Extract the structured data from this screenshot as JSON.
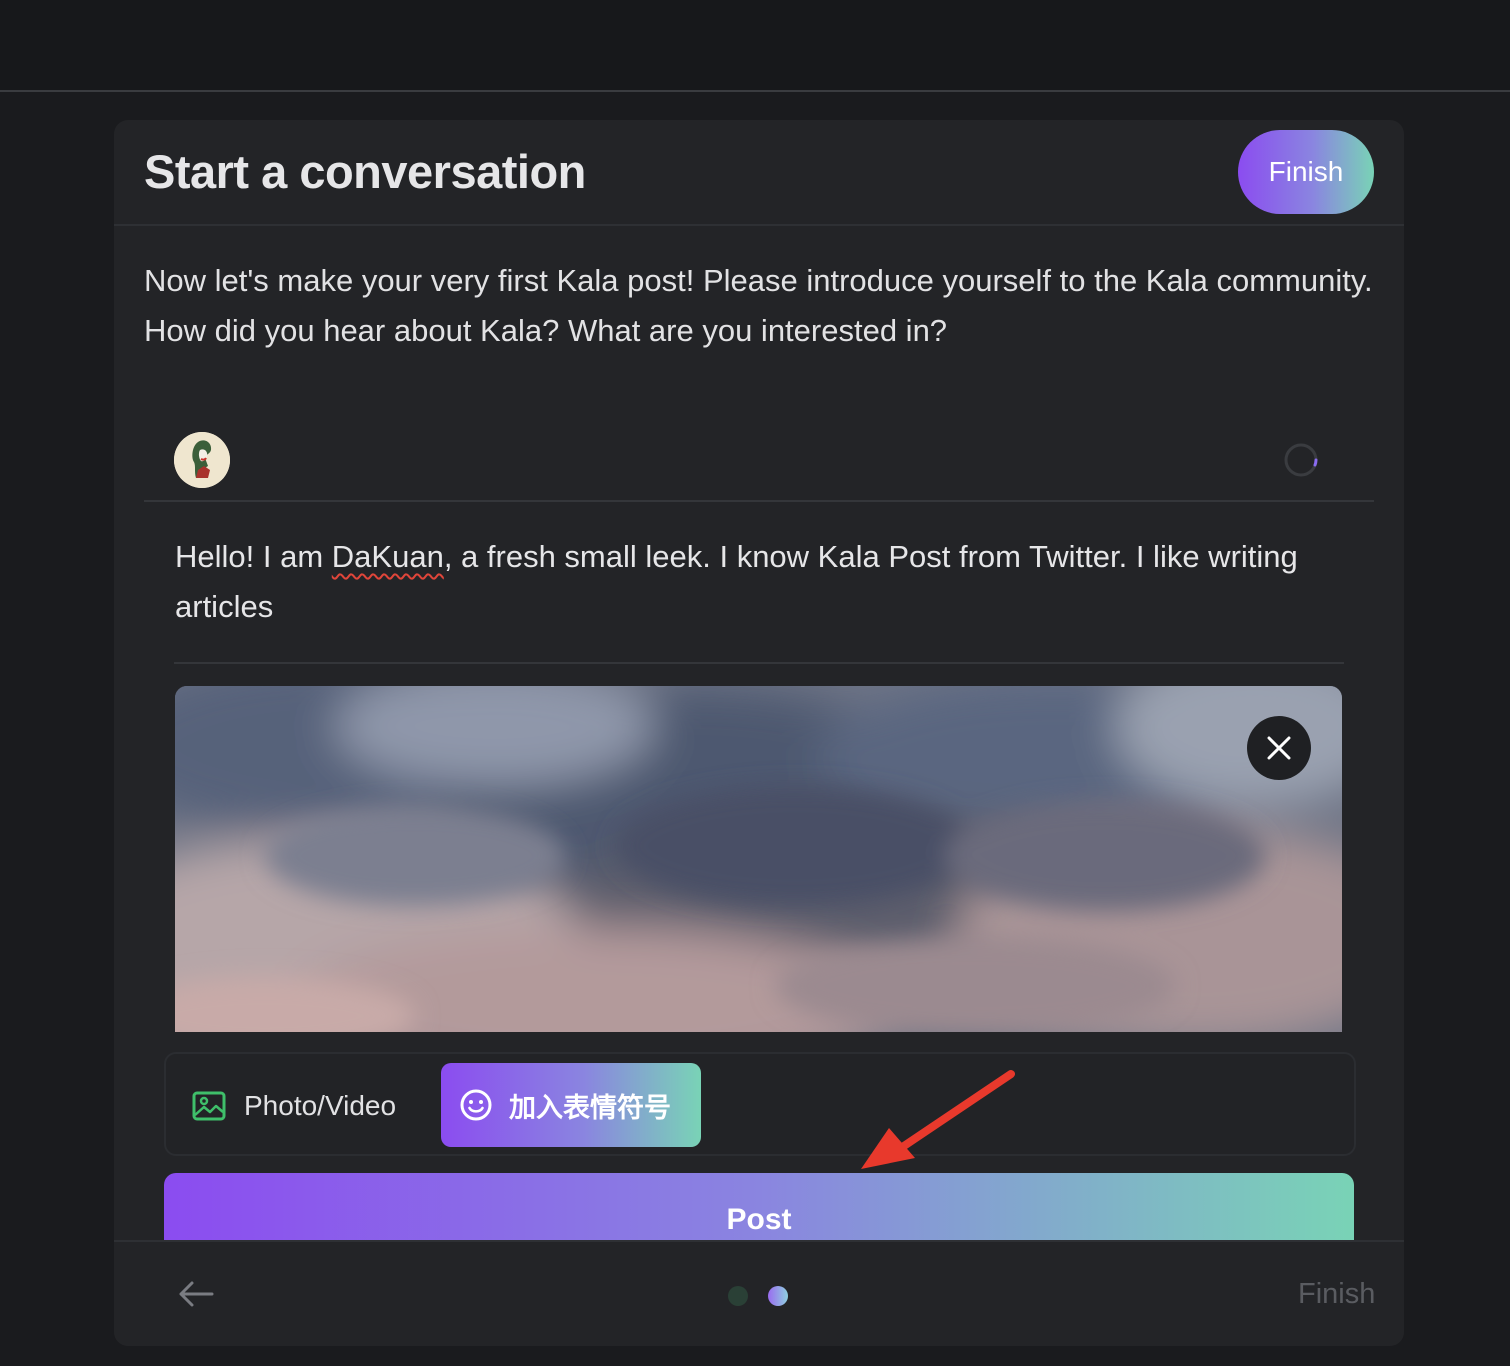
{
  "modal": {
    "title": "Start a conversation",
    "finish_label": "Finish",
    "intro": "Now let's make your very first Kala post! Please introduce yourself to the Kala community. How did you hear about Kala? What are you interested in?"
  },
  "composer": {
    "text_before": "Hello! I am ",
    "text_misspelled": "DaKuan",
    "text_after": ", a fresh small leek. I know Kala Post from Twitter. I like writing articles"
  },
  "toolbar": {
    "photo_label": "Photo/Video",
    "emoji_label": "加入表情符号",
    "photo_icon": "image-icon",
    "emoji_icon": "smiley-icon"
  },
  "post_label": "Post",
  "footer": {
    "finish_label": "Finish",
    "page_count": 2,
    "current_page": 2
  },
  "colors": {
    "accent_start": "#8b4cf0",
    "accent_mid": "#8a85e0",
    "accent_end": "#79d3b6",
    "annotation_arrow": "#e8392c"
  }
}
